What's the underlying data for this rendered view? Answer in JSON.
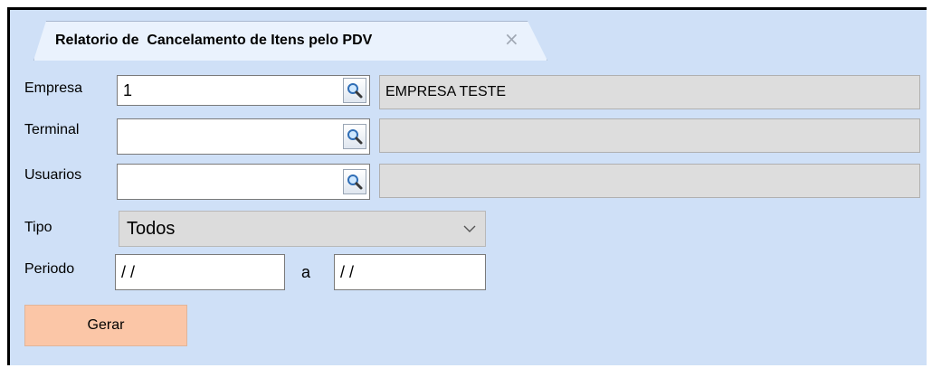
{
  "tab": {
    "title": "Relatorio de  Cancelamento de Itens pelo PDV",
    "close_glyph": "×"
  },
  "form": {
    "empresa": {
      "label": "Empresa",
      "code": "1",
      "description": "EMPRESA TESTE",
      "lookup_icon": "search-icon"
    },
    "terminal": {
      "label": "Terminal",
      "code": "",
      "description": "",
      "lookup_icon": "search-icon"
    },
    "usuarios": {
      "label": "Usuarios",
      "code": "",
      "description": "",
      "lookup_icon": "search-icon"
    },
    "tipo": {
      "label": "Tipo",
      "selected": "Todos"
    },
    "periodo": {
      "label": "Periodo",
      "start": " / /",
      "separator": "a",
      "end": " / /"
    }
  },
  "actions": {
    "gerar_label": "Gerar"
  },
  "colors": {
    "panel_bg": "#cfe0f7",
    "gerar_bg": "#fbc6a7",
    "readonly_bg": "#dddddd"
  }
}
